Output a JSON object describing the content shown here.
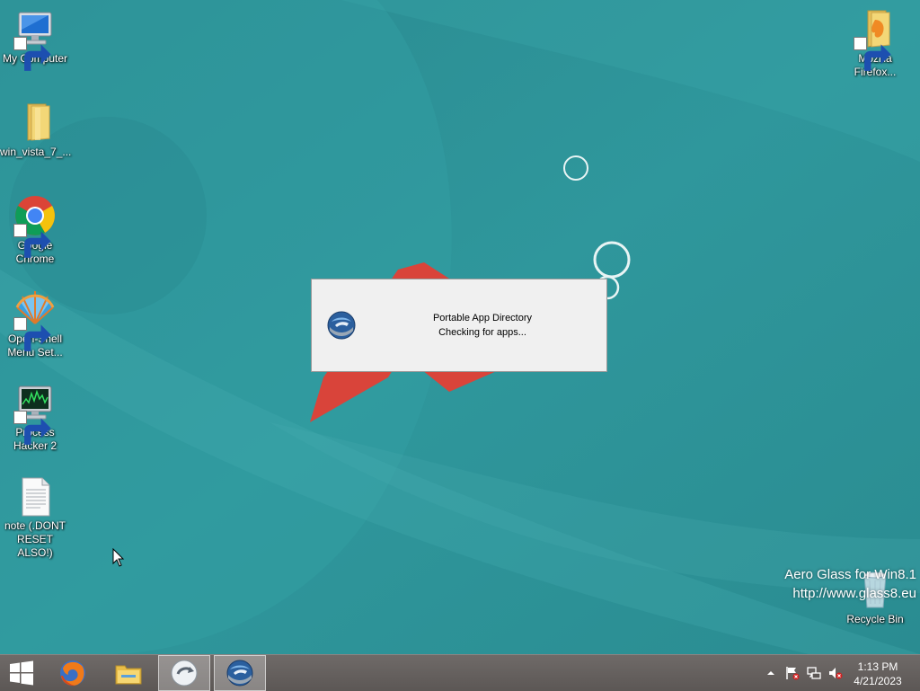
{
  "desktop": {
    "icons": [
      {
        "label": "My Computer",
        "icon": "computer-icon"
      },
      {
        "label": "win_vista_7_...",
        "icon": "folder-icon"
      },
      {
        "label": "Google\nChrome",
        "icon": "chrome-icon"
      },
      {
        "label": "Open-Shell\nMenu Set...",
        "icon": "open-shell-icon"
      },
      {
        "label": "Process\nHacker 2",
        "icon": "process-hacker-icon"
      },
      {
        "label": "note (.DONT\nRESET ALSO!)",
        "icon": "text-file-icon"
      },
      {
        "label": "Mozilla\nFirefox...",
        "icon": "folder-icon"
      },
      {
        "label": "Recycle Bin",
        "icon": "recycle-bin-icon"
      }
    ],
    "watermark": {
      "line1": "Aero Glass for Win8.1",
      "line2": "http://www.glass8.eu"
    }
  },
  "dialog": {
    "title": "Portable App Directory",
    "status": "Checking for apps...",
    "icon": "portable-app-directory-icon"
  },
  "taskbar": {
    "start_icon": "windows-logo-icon",
    "buttons": [
      {
        "name": "Firefox",
        "icon": "firefox-icon",
        "active": false
      },
      {
        "name": "File Explorer",
        "icon": "file-explorer-icon",
        "active": false
      },
      {
        "name": "App",
        "icon": "circle-arrow-icon",
        "active": true
      },
      {
        "name": "Portable App Directory",
        "icon": "portable-app-directory-icon",
        "active": true
      }
    ],
    "tray": {
      "icons": [
        "show-hidden-icons-chevron",
        "action-center-flag-icon",
        "network-icon",
        "volume-muted-icon"
      ],
      "time": "1:13 PM",
      "date": "4/21/2023"
    }
  },
  "colors": {
    "desktop_bg": "#2b8f94",
    "accent_red": "#d9443a",
    "taskbar": "#625d5b"
  }
}
